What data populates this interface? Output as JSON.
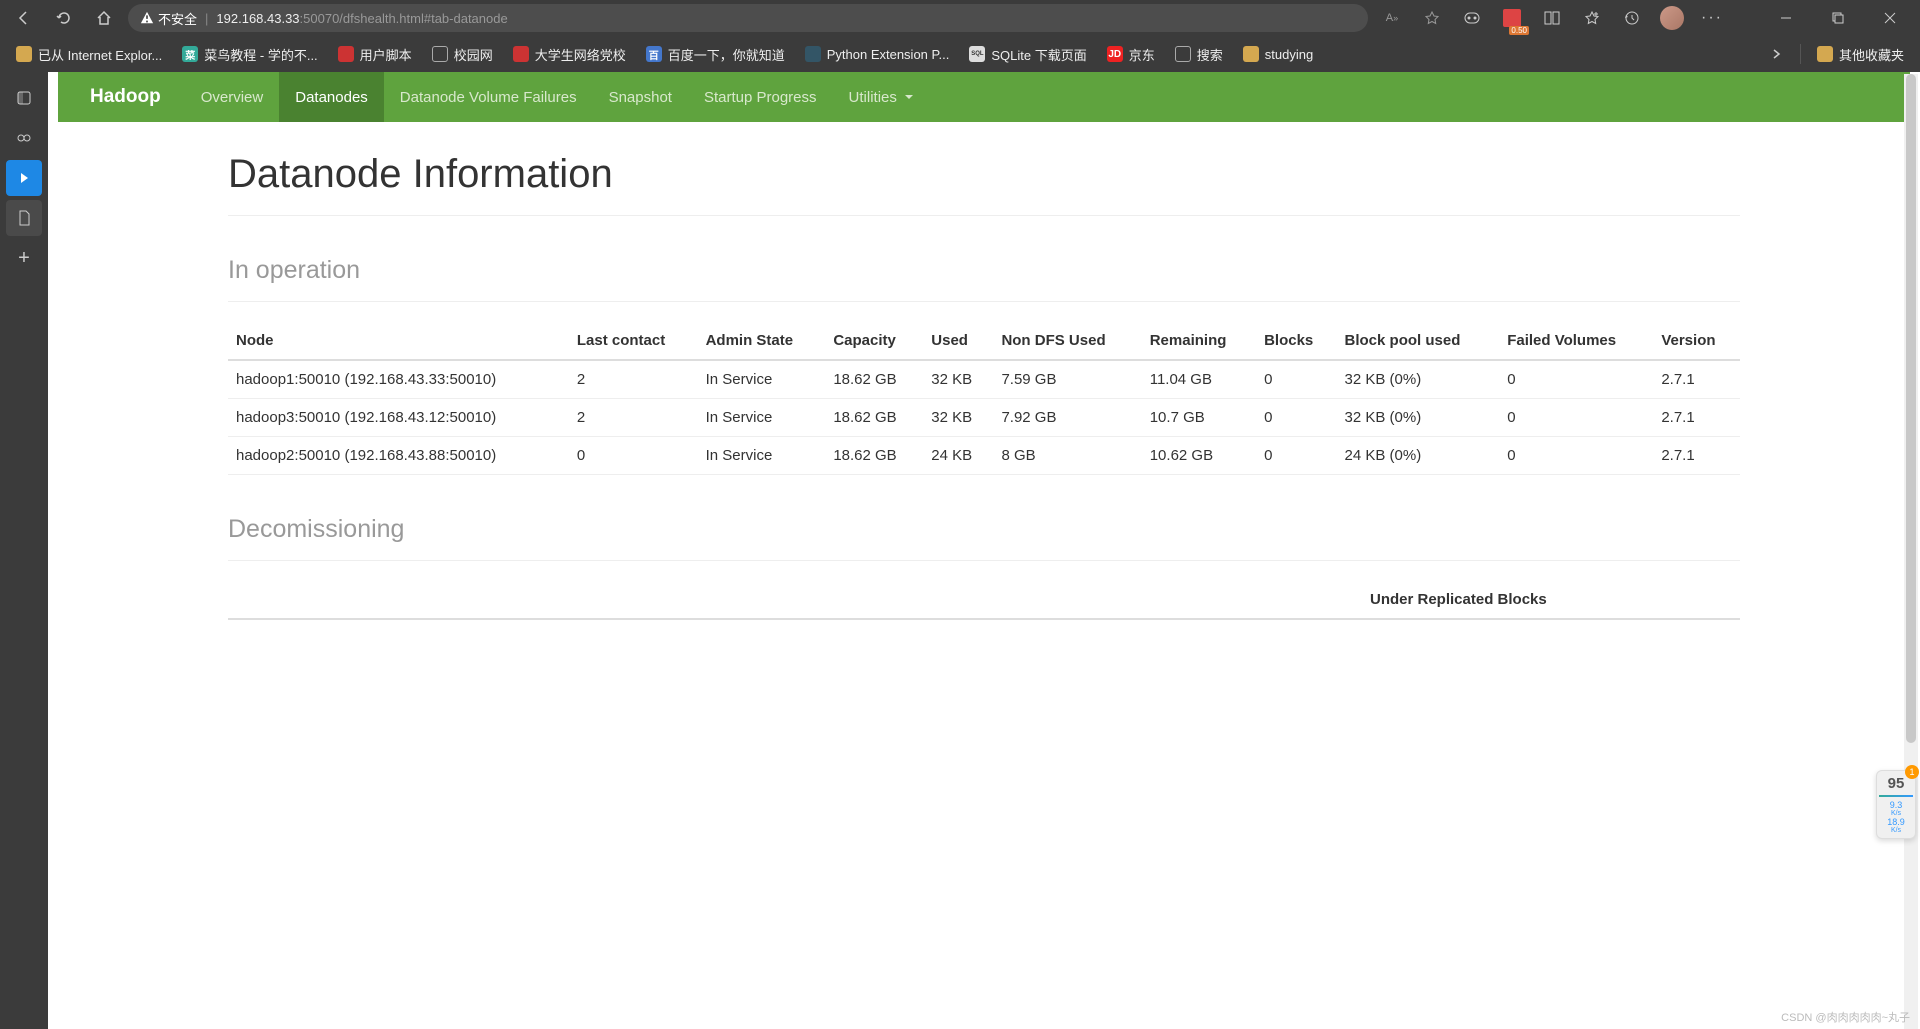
{
  "browser": {
    "security_label": "不安全",
    "url_host": "192.168.43.33",
    "url_path": ":50070/dfshealth.html#tab-datanode"
  },
  "bookmarks": [
    {
      "icon": "folder",
      "label": "已从 Internet Explor..."
    },
    {
      "icon": "green",
      "label": "菜鸟教程 - 学的不..."
    },
    {
      "icon": "red",
      "label": "用户脚本"
    },
    {
      "icon": "file",
      "label": "校园网"
    },
    {
      "icon": "red",
      "label": "大学生网络党校"
    },
    {
      "icon": "blue",
      "label": "百度一下，你就知道"
    },
    {
      "icon": "py",
      "label": "Python Extension P..."
    },
    {
      "icon": "sql",
      "label": "SQLite 下载页面"
    },
    {
      "icon": "jd",
      "label": "京东"
    },
    {
      "icon": "file",
      "label": "搜索"
    },
    {
      "icon": "folder",
      "label": "studying"
    }
  ],
  "bookmarks_right": {
    "icon": "folder",
    "label": "其他收藏夹"
  },
  "hadoop_nav": {
    "brand": "Hadoop",
    "items": [
      {
        "label": "Overview",
        "active": false
      },
      {
        "label": "Datanodes",
        "active": true
      },
      {
        "label": "Datanode Volume Failures",
        "active": false
      },
      {
        "label": "Snapshot",
        "active": false
      },
      {
        "label": "Startup Progress",
        "active": false
      },
      {
        "label": "Utilities",
        "active": false,
        "dropdown": true
      }
    ]
  },
  "page": {
    "title": "Datanode Information",
    "section1": "In operation",
    "section2": "Decomissioning",
    "table1": {
      "headers": [
        "Node",
        "Last contact",
        "Admin State",
        "Capacity",
        "Used",
        "Non DFS Used",
        "Remaining",
        "Blocks",
        "Block pool used",
        "Failed Volumes",
        "Version"
      ],
      "rows": [
        [
          "hadoop1:50010 (192.168.43.33:50010)",
          "2",
          "In Service",
          "18.62 GB",
          "32 KB",
          "7.59 GB",
          "11.04 GB",
          "0",
          "32 KB (0%)",
          "0",
          "2.7.1"
        ],
        [
          "hadoop3:50010 (192.168.43.12:50010)",
          "2",
          "In Service",
          "18.62 GB",
          "32 KB",
          "7.92 GB",
          "10.7 GB",
          "0",
          "32 KB (0%)",
          "0",
          "2.7.1"
        ],
        [
          "hadoop2:50010 (192.168.43.88:50010)",
          "0",
          "In Service",
          "18.62 GB",
          "24 KB",
          "8 GB",
          "10.62 GB",
          "0",
          "24 KB (0%)",
          "0",
          "2.7.1"
        ]
      ]
    },
    "table2_header_partial": "Under Replicated Blocks"
  },
  "widget": {
    "badge": "1",
    "big": "95",
    "up": "9.3",
    "up_unit": "K/s",
    "down": "18.9",
    "down_unit": "K/s"
  },
  "watermark": "CSDN @肉肉肉肉肉~丸子"
}
